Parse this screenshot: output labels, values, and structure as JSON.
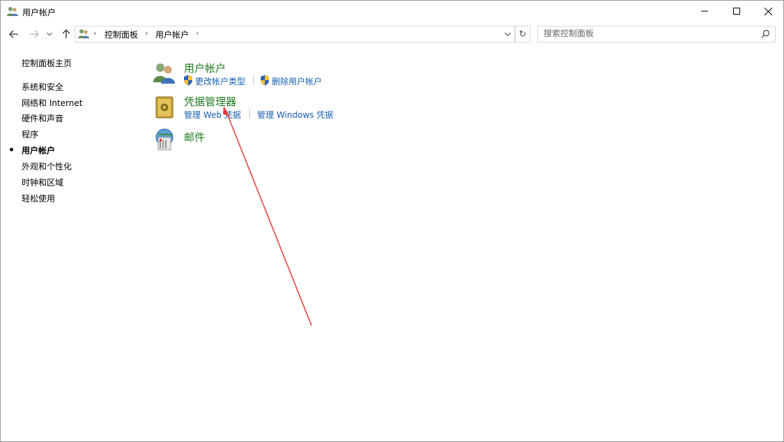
{
  "window": {
    "title": "用户帐户",
    "controls": {
      "minimize": "minimize",
      "maximize": "maximize",
      "close": "close"
    }
  },
  "address": {
    "breadcrumbs": [
      "控制面板",
      "用户帐户"
    ]
  },
  "search": {
    "placeholder": "搜索控制面板"
  },
  "sidebar": {
    "home": "控制面板主页",
    "items": [
      {
        "label": "系统和安全"
      },
      {
        "label": "网络和 Internet"
      },
      {
        "label": "硬件和声音"
      },
      {
        "label": "程序"
      },
      {
        "label": "用户帐户",
        "selected": true
      },
      {
        "label": "外观和个性化"
      },
      {
        "label": "时钟和区域"
      },
      {
        "label": "轻松使用"
      }
    ]
  },
  "categories": [
    {
      "title": "用户帐户",
      "icon": "users-icon",
      "links": [
        "更改帐户类型",
        "删除用户帐户"
      ]
    },
    {
      "title": "凭据管理器",
      "icon": "vault-icon",
      "links": [
        "管理 Web 凭据",
        "管理 Windows 凭据"
      ]
    },
    {
      "title": "邮件",
      "icon": "mail-icon",
      "links": []
    }
  ],
  "colors": {
    "category_title": "#1e7a1e",
    "link": "#1a5fb4",
    "annotation_arrow": "#e53935"
  }
}
